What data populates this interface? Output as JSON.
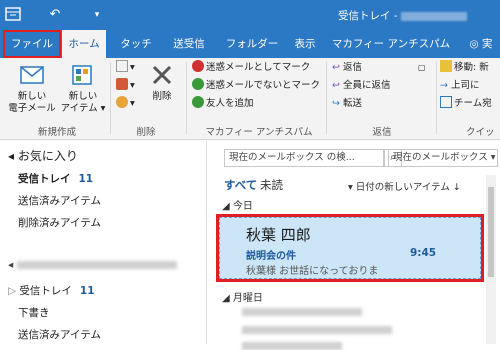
{
  "titlebar": {
    "title": "受信トレイ -",
    "colors": {
      "bar": "#2b78c5",
      "accent": "#1e5aa0",
      "highlight": "#e02020"
    }
  },
  "tabs": [
    {
      "label": "ファイル"
    },
    {
      "label": "ホーム"
    },
    {
      "label": "タッチ"
    },
    {
      "label": "送受信"
    },
    {
      "label": "フォルダー"
    },
    {
      "label": "表示"
    },
    {
      "label": "マカフィー アンチスパム"
    },
    {
      "label": "実"
    }
  ],
  "ribbon": {
    "new_group": {
      "new_mail": "新しい\n電子メール",
      "new_items": "新しい\nアイテム ▾",
      "label": "新規作成"
    },
    "delete_group": {
      "delete": "削除",
      "label": "削除"
    },
    "spam_group": {
      "mark_spam": "迷惑メールとしてマーク",
      "mark_not_spam": "迷惑メールでないとマーク",
      "add_friend": "友人を追加",
      "label": "マカフィー アンチスパム"
    },
    "respond_group": {
      "reply": "返信",
      "reply_all": "全員に返信",
      "forward": "転送",
      "label": "返信"
    },
    "quick_group": {
      "move": "移動: 新",
      "to_manager": "上司に",
      "team": "チーム宛",
      "label": "クイッ"
    }
  },
  "sidebar": {
    "favorites": "お気に入り",
    "items": [
      {
        "label": "受信トレイ",
        "count": "11"
      },
      {
        "label": "送信済みアイテム"
      },
      {
        "label": "削除済みアイテム"
      }
    ],
    "account_items": [
      {
        "label": "受信トレイ",
        "count": "11"
      },
      {
        "label": "下書き"
      },
      {
        "label": "送信済みアイテム"
      }
    ]
  },
  "main": {
    "search_placeholder": "現在のメールボックス の検...",
    "scope": "現在のメールボックス",
    "filter_all": "すべて",
    "filter_unread": "未読",
    "sort": "日付の新しいアイテム ↓",
    "today": "今日",
    "monday": "月曜日",
    "mail": {
      "sender": "秋葉 四郎",
      "subject": "説明会の件",
      "time": "9:45",
      "preview": "秋葉様 お世話になっておりま"
    }
  }
}
